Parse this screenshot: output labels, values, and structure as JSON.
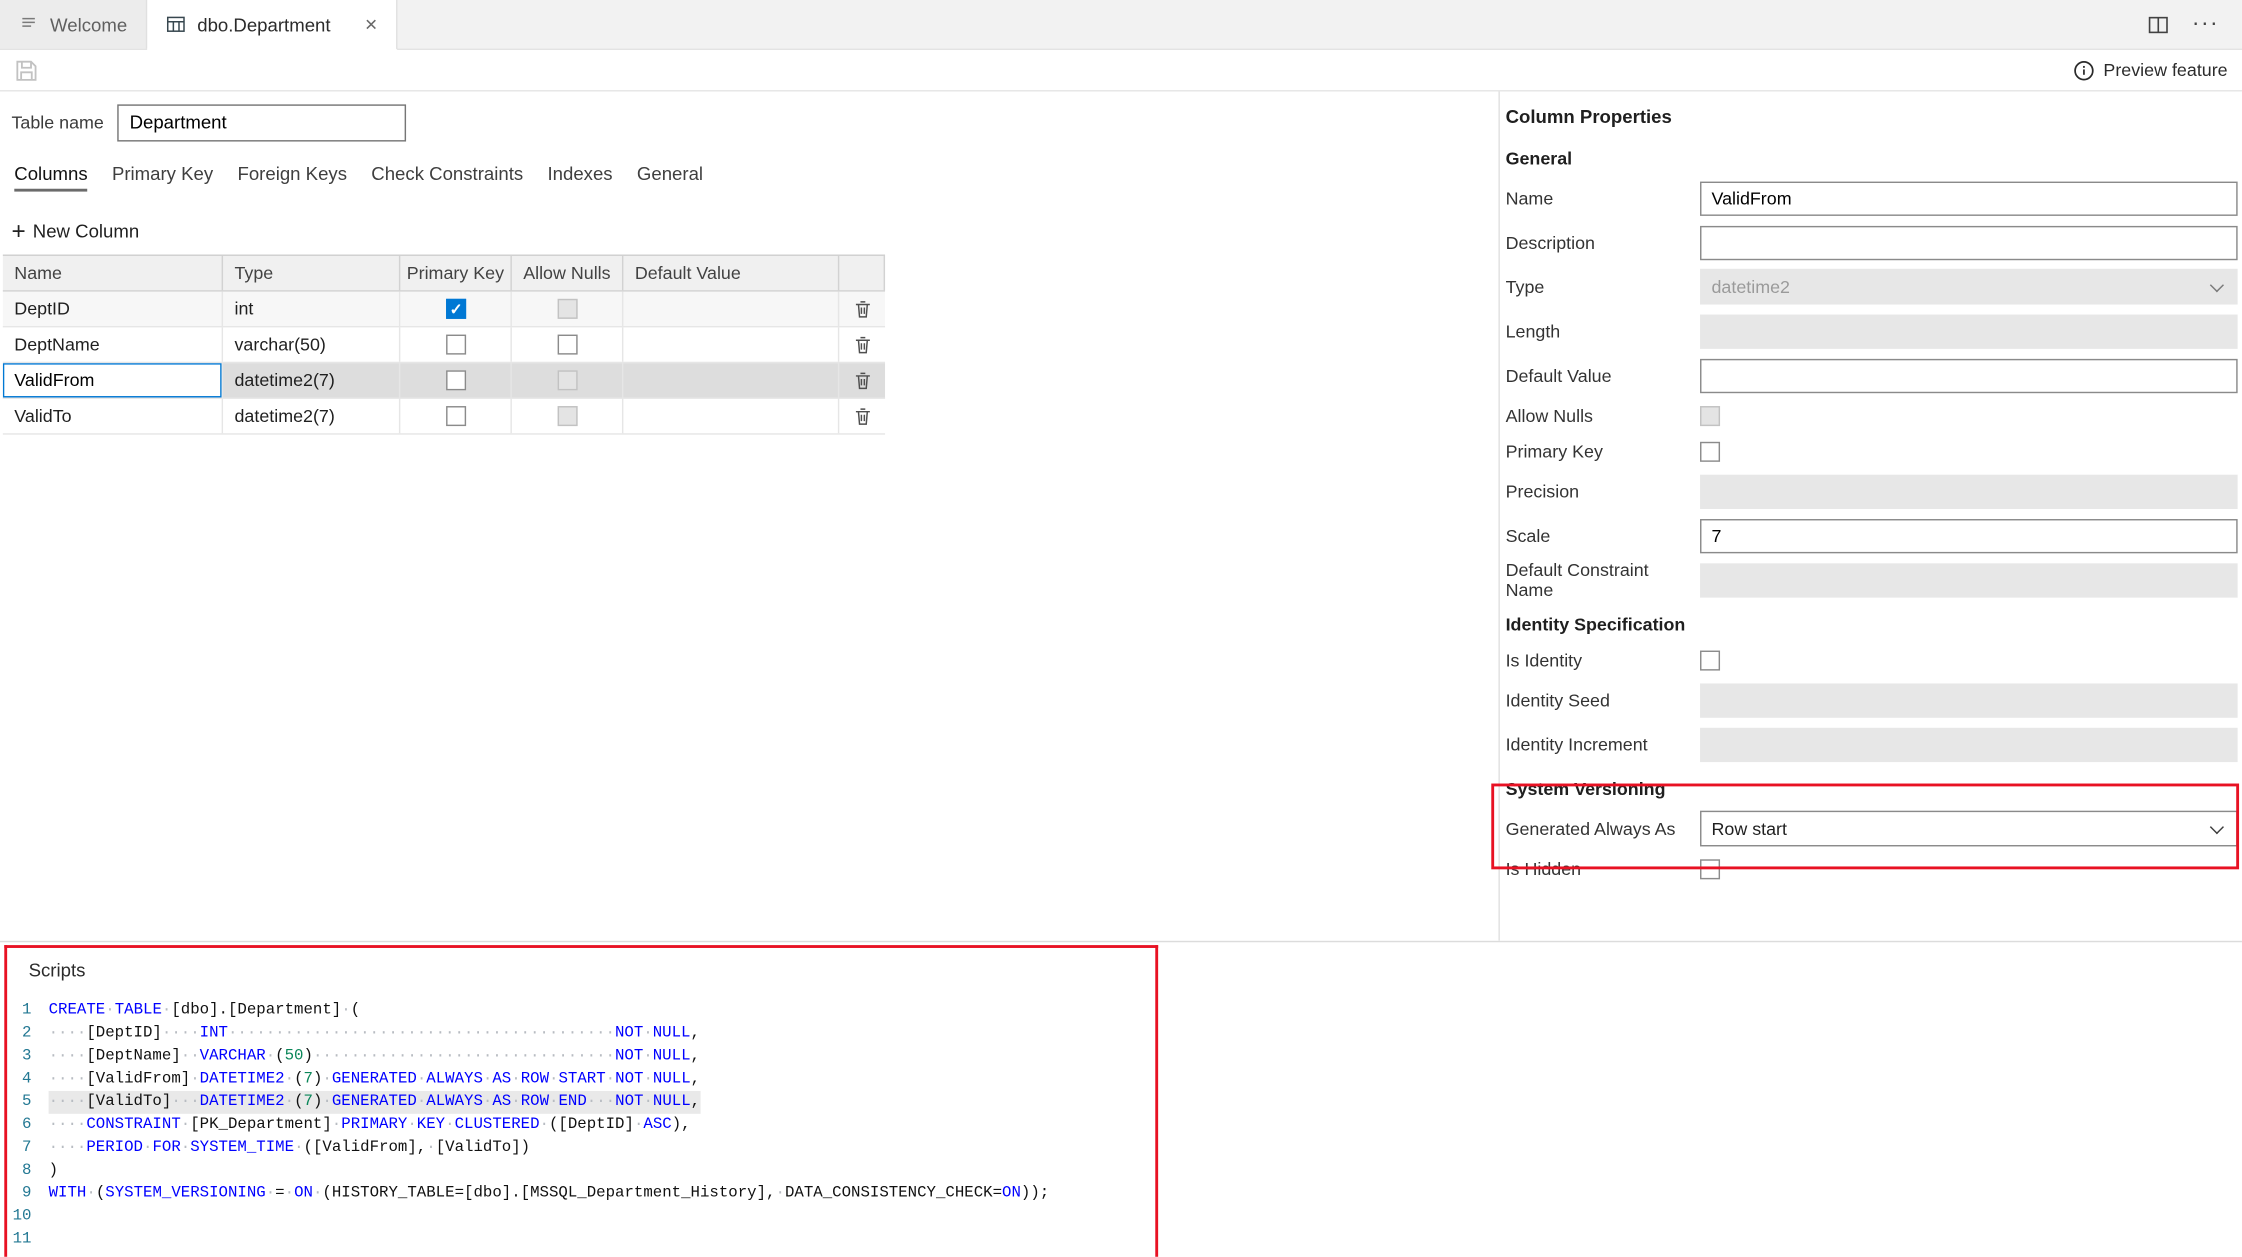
{
  "colors": {
    "accent": "#0078d4",
    "annotation": "#e81123",
    "keyword": "#0000ff",
    "number": "#098658",
    "linenumber": "#237893",
    "whitespace": "#b8bcc2"
  },
  "titlebar": {
    "tabs": [
      {
        "label": "Welcome"
      },
      {
        "label": "dbo.Department",
        "active": true
      }
    ],
    "close_glyph": "×"
  },
  "toolbar": {
    "preview_feature_label": "Preview feature"
  },
  "designer": {
    "table_name_label": "Table name",
    "table_name_value": "Department",
    "tabs": [
      "Columns",
      "Primary Key",
      "Foreign Keys",
      "Check Constraints",
      "Indexes",
      "General"
    ],
    "active_tab": "Columns",
    "new_column_label": "New Column",
    "grid": {
      "headers": [
        "Name",
        "Type",
        "Primary Key",
        "Allow Nulls",
        "Default Value"
      ],
      "rows": [
        {
          "name": "DeptID",
          "type": "int",
          "primary_key": true,
          "allow_nulls": false,
          "allow_nulls_disabled": true,
          "default_value": ""
        },
        {
          "name": "DeptName",
          "type": "varchar(50)",
          "primary_key": false,
          "allow_nulls": false,
          "allow_nulls_disabled": false,
          "default_value": ""
        },
        {
          "name": "ValidFrom",
          "type": "datetime2(7)",
          "primary_key": false,
          "allow_nulls": false,
          "allow_nulls_disabled": true,
          "default_value": "",
          "editing": true,
          "selected": true
        },
        {
          "name": "ValidTo",
          "type": "datetime2(7)",
          "primary_key": false,
          "allow_nulls": false,
          "allow_nulls_disabled": true,
          "default_value": ""
        }
      ]
    }
  },
  "properties": {
    "title": "Column Properties",
    "general_header": "General",
    "fields": {
      "name": {
        "label": "Name",
        "value": "ValidFrom"
      },
      "description": {
        "label": "Description",
        "value": ""
      },
      "type": {
        "label": "Type",
        "value": "datetime2"
      },
      "length": {
        "label": "Length",
        "value": ""
      },
      "default_value": {
        "label": "Default Value",
        "value": ""
      },
      "allow_nulls": {
        "label": "Allow Nulls",
        "checked": false
      },
      "primary_key": {
        "label": "Primary Key",
        "checked": false
      },
      "precision": {
        "label": "Precision",
        "value": ""
      },
      "scale": {
        "label": "Scale",
        "value": "7"
      },
      "default_constraint": {
        "label": "Default Constraint Name",
        "value": ""
      }
    },
    "identity_header": "Identity Specification",
    "identity": {
      "is_identity": {
        "label": "Is Identity",
        "checked": false
      },
      "seed": {
        "label": "Identity Seed",
        "value": ""
      },
      "increment": {
        "label": "Identity Increment",
        "value": ""
      }
    },
    "system_versioning_header": "System Versioning",
    "system_versioning": {
      "generated_always_as": {
        "label": "Generated Always As",
        "value": "Row start"
      },
      "is_hidden": {
        "label": "Is Hidden",
        "checked": false
      }
    }
  },
  "scripts": {
    "title": "Scripts",
    "lines": [
      {
        "num": "1",
        "segments": [
          {
            "t": "CREATE",
            "c": "keyword"
          },
          {
            "t": "·",
            "c": "whitespace"
          },
          {
            "t": "TABLE",
            "c": "keyword"
          },
          {
            "t": "·",
            "c": "whitespace"
          },
          {
            "t": "[dbo].[Department]",
            "c": "ident"
          },
          {
            "t": "·",
            "c": "whitespace"
          },
          {
            "t": "(",
            "c": "punct"
          }
        ]
      },
      {
        "num": "2",
        "segments": [
          {
            "t": "····",
            "c": "whitespace"
          },
          {
            "t": "[DeptID]",
            "c": "ident"
          },
          {
            "t": "····",
            "c": "whitespace"
          },
          {
            "t": "INT",
            "c": "keyword"
          },
          {
            "t": "·········································",
            "c": "whitespace"
          },
          {
            "t": "NOT",
            "c": "keyword"
          },
          {
            "t": "·",
            "c": "whitespace"
          },
          {
            "t": "NULL",
            "c": "keyword"
          },
          {
            "t": ",",
            "c": "punct"
          }
        ]
      },
      {
        "num": "3",
        "segments": [
          {
            "t": "····",
            "c": "whitespace"
          },
          {
            "t": "[DeptName]",
            "c": "ident"
          },
          {
            "t": "··",
            "c": "whitespace"
          },
          {
            "t": "VARCHAR",
            "c": "keyword"
          },
          {
            "t": "·",
            "c": "whitespace"
          },
          {
            "t": "(",
            "c": "punct"
          },
          {
            "t": "50",
            "c": "number"
          },
          {
            "t": ")",
            "c": "punct"
          },
          {
            "t": "································",
            "c": "whitespace"
          },
          {
            "t": "NOT",
            "c": "keyword"
          },
          {
            "t": "·",
            "c": "whitespace"
          },
          {
            "t": "NULL",
            "c": "keyword"
          },
          {
            "t": ",",
            "c": "punct"
          }
        ]
      },
      {
        "num": "4",
        "segments": [
          {
            "t": "····",
            "c": "whitespace"
          },
          {
            "t": "[ValidFrom]",
            "c": "ident"
          },
          {
            "t": "·",
            "c": "whitespace"
          },
          {
            "t": "DATETIME2",
            "c": "keyword"
          },
          {
            "t": "·",
            "c": "whitespace"
          },
          {
            "t": "(",
            "c": "punct"
          },
          {
            "t": "7",
            "c": "number"
          },
          {
            "t": ")",
            "c": "punct"
          },
          {
            "t": "·",
            "c": "whitespace"
          },
          {
            "t": "GENERATED",
            "c": "keyword"
          },
          {
            "t": "·",
            "c": "whitespace"
          },
          {
            "t": "ALWAYS",
            "c": "keyword"
          },
          {
            "t": "·",
            "c": "whitespace"
          },
          {
            "t": "AS",
            "c": "keyword"
          },
          {
            "t": "·",
            "c": "whitespace"
          },
          {
            "t": "ROW",
            "c": "keyword"
          },
          {
            "t": "·",
            "c": "whitespace"
          },
          {
            "t": "START",
            "c": "keyword"
          },
          {
            "t": "·",
            "c": "whitespace"
          },
          {
            "t": "NOT",
            "c": "keyword"
          },
          {
            "t": "·",
            "c": "whitespace"
          },
          {
            "t": "NULL",
            "c": "keyword"
          },
          {
            "t": ",",
            "c": "punct"
          }
        ]
      },
      {
        "num": "5",
        "current": true,
        "segments": [
          {
            "t": "····",
            "c": "whitespace"
          },
          {
            "t": "[ValidTo]",
            "c": "ident"
          },
          {
            "t": "···",
            "c": "whitespace"
          },
          {
            "t": "DATETIME2",
            "c": "keyword"
          },
          {
            "t": "·",
            "c": "whitespace"
          },
          {
            "t": "(",
            "c": "punct"
          },
          {
            "t": "7",
            "c": "number"
          },
          {
            "t": ")",
            "c": "punct"
          },
          {
            "t": "·",
            "c": "whitespace"
          },
          {
            "t": "GENERATED",
            "c": "keyword"
          },
          {
            "t": "·",
            "c": "whitespace"
          },
          {
            "t": "ALWAYS",
            "c": "keyword"
          },
          {
            "t": "·",
            "c": "whitespace"
          },
          {
            "t": "AS",
            "c": "keyword"
          },
          {
            "t": "·",
            "c": "whitespace"
          },
          {
            "t": "ROW",
            "c": "keyword"
          },
          {
            "t": "·",
            "c": "whitespace"
          },
          {
            "t": "END",
            "c": "keyword"
          },
          {
            "t": "···",
            "c": "whitespace"
          },
          {
            "t": "NOT",
            "c": "keyword"
          },
          {
            "t": "·",
            "c": "whitespace"
          },
          {
            "t": "NULL",
            "c": "keyword"
          },
          {
            "t": ",",
            "c": "punct"
          }
        ]
      },
      {
        "num": "6",
        "segments": [
          {
            "t": "····",
            "c": "whitespace"
          },
          {
            "t": "CONSTRAINT",
            "c": "keyword"
          },
          {
            "t": "·",
            "c": "whitespace"
          },
          {
            "t": "[PK_Department]",
            "c": "ident"
          },
          {
            "t": "·",
            "c": "whitespace"
          },
          {
            "t": "PRIMARY",
            "c": "keyword"
          },
          {
            "t": "·",
            "c": "whitespace"
          },
          {
            "t": "KEY",
            "c": "keyword"
          },
          {
            "t": "·",
            "c": "whitespace"
          },
          {
            "t": "CLUSTERED",
            "c": "keyword"
          },
          {
            "t": "·",
            "c": "whitespace"
          },
          {
            "t": "(",
            "c": "punct"
          },
          {
            "t": "[DeptID]",
            "c": "ident"
          },
          {
            "t": "·",
            "c": "whitespace"
          },
          {
            "t": "ASC",
            "c": "keyword"
          },
          {
            "t": "),",
            "c": "punct"
          }
        ]
      },
      {
        "num": "7",
        "segments": [
          {
            "t": "····",
            "c": "whitespace"
          },
          {
            "t": "PERIOD",
            "c": "keyword"
          },
          {
            "t": "·",
            "c": "whitespace"
          },
          {
            "t": "FOR",
            "c": "keyword"
          },
          {
            "t": "·",
            "c": "whitespace"
          },
          {
            "t": "SYSTEM_TIME",
            "c": "keyword"
          },
          {
            "t": "·",
            "c": "whitespace"
          },
          {
            "t": "(",
            "c": "punct"
          },
          {
            "t": "[ValidFrom]",
            "c": "ident"
          },
          {
            "t": ",",
            "c": "punct"
          },
          {
            "t": "·",
            "c": "whitespace"
          },
          {
            "t": "[ValidTo]",
            "c": "ident"
          },
          {
            "t": ")",
            "c": "punct"
          }
        ]
      },
      {
        "num": "8",
        "segments": [
          {
            "t": ")",
            "c": "punct"
          }
        ]
      },
      {
        "num": "9",
        "segments": [
          {
            "t": "WITH",
            "c": "keyword"
          },
          {
            "t": "·",
            "c": "whitespace"
          },
          {
            "t": "(",
            "c": "punct"
          },
          {
            "t": "SYSTEM_VERSIONING",
            "c": "keyword"
          },
          {
            "t": "·",
            "c": "whitespace"
          },
          {
            "t": "=",
            "c": "punct"
          },
          {
            "t": "·",
            "c": "whitespace"
          },
          {
            "t": "ON",
            "c": "keyword"
          },
          {
            "t": "·",
            "c": "whitespace"
          },
          {
            "t": "(",
            "c": "punct"
          },
          {
            "t": "HISTORY_TABLE",
            "c": "ident"
          },
          {
            "t": "=",
            "c": "punct"
          },
          {
            "t": "[dbo].[MSSQL_Department_History]",
            "c": "ident"
          },
          {
            "t": ",",
            "c": "punct"
          },
          {
            "t": "·",
            "c": "whitespace"
          },
          {
            "t": "DATA_CONSISTENCY_CHECK",
            "c": "ident"
          },
          {
            "t": "=",
            "c": "punct"
          },
          {
            "t": "ON",
            "c": "keyword"
          },
          {
            "t": "));",
            "c": "punct"
          }
        ]
      },
      {
        "num": "10",
        "segments": []
      },
      {
        "num": "11",
        "segments": []
      }
    ]
  }
}
